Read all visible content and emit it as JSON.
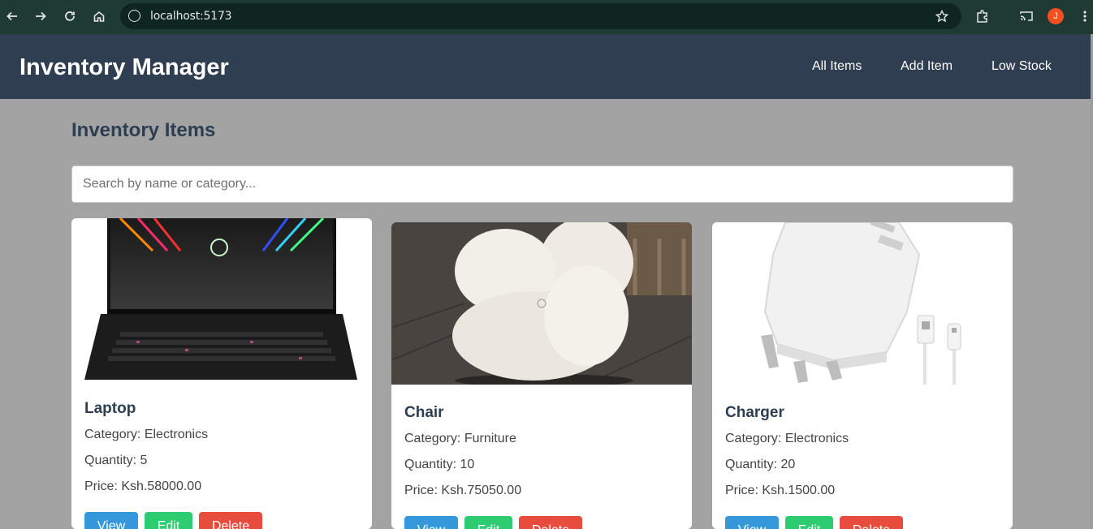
{
  "browser": {
    "url": "localhost:5173",
    "profile_initial": "J"
  },
  "header": {
    "title": "Inventory Manager",
    "nav": [
      {
        "label": "All Items"
      },
      {
        "label": "Add Item"
      },
      {
        "label": "Low Stock"
      }
    ]
  },
  "main": {
    "heading": "Inventory Items",
    "search_placeholder": "Search by name or category..."
  },
  "items": [
    {
      "name": "Laptop",
      "category": "Category: Electronics",
      "quantity": "Quantity: 5",
      "price": "Price: Ksh.58000.00"
    },
    {
      "name": "Chair",
      "category": "Category: Furniture",
      "quantity": "Quantity: 10",
      "price": "Price: Ksh.75050.00"
    },
    {
      "name": "Charger",
      "category": "Category: Electronics",
      "quantity": "Quantity: 20",
      "price": "Price: Ksh.1500.00"
    }
  ],
  "buttons": {
    "view": "View",
    "edit": "Edit",
    "delete": "Delete"
  },
  "colors": {
    "header_bg": "#2f3e50",
    "view": "#3498db",
    "edit": "#2ecc71",
    "delete": "#e74c3c"
  }
}
